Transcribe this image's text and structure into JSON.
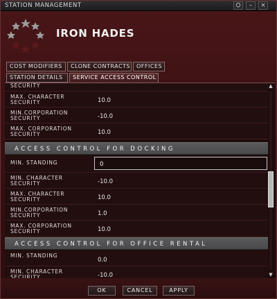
{
  "window": {
    "title": "STATION MANAGEMENT",
    "buttons": {
      "pin": "⛭",
      "minimize": "–",
      "close": "×"
    }
  },
  "station": {
    "name": "IRON HADES"
  },
  "tabs": {
    "row1": [
      "COST MODIFIERS",
      "CLONE CONTRACTS",
      "OFFICES"
    ],
    "row2": [
      "STATION DETAILS",
      "SERVICE ACCESS CONTROL"
    ]
  },
  "rows_top": [
    {
      "label": "SECURITY",
      "value": ""
    },
    {
      "label": "MAX. CHARACTER SECURITY",
      "value": "10.0"
    },
    {
      "label": "MIN.CORPORATION SECURITY",
      "value": "-10.0"
    },
    {
      "label": "MAX. CORPORATION SECURITY",
      "value": "10.0"
    }
  ],
  "docking": {
    "header": "ACCESS CONTROL FOR DOCKING",
    "min_standing_label": "MIN. STANDING",
    "min_standing_value": "0",
    "rows": [
      {
        "label": "MIN. CHARACTER SECURITY",
        "value": "-10.0"
      },
      {
        "label": "MAX. CHARACTER SECURITY",
        "value": "10.0"
      },
      {
        "label": "MIN.CORPORATION SECURITY",
        "value": "1.0"
      },
      {
        "label": "MAX. CORPORATION SECURITY",
        "value": "10.0"
      }
    ]
  },
  "office_rental": {
    "header": "ACCESS CONTROL FOR OFFICE RENTAL",
    "rows": [
      {
        "label": "MIN. STANDING",
        "value": "0.0"
      },
      {
        "label": "MIN. CHARACTER SECURITY",
        "value": "-10.0"
      }
    ]
  },
  "footer": {
    "ok": "OK",
    "cancel": "CANCEL",
    "apply": "APPLY"
  },
  "colors": {
    "accent": "#4a1618",
    "section": "#555557",
    "text": "#e6dede"
  }
}
